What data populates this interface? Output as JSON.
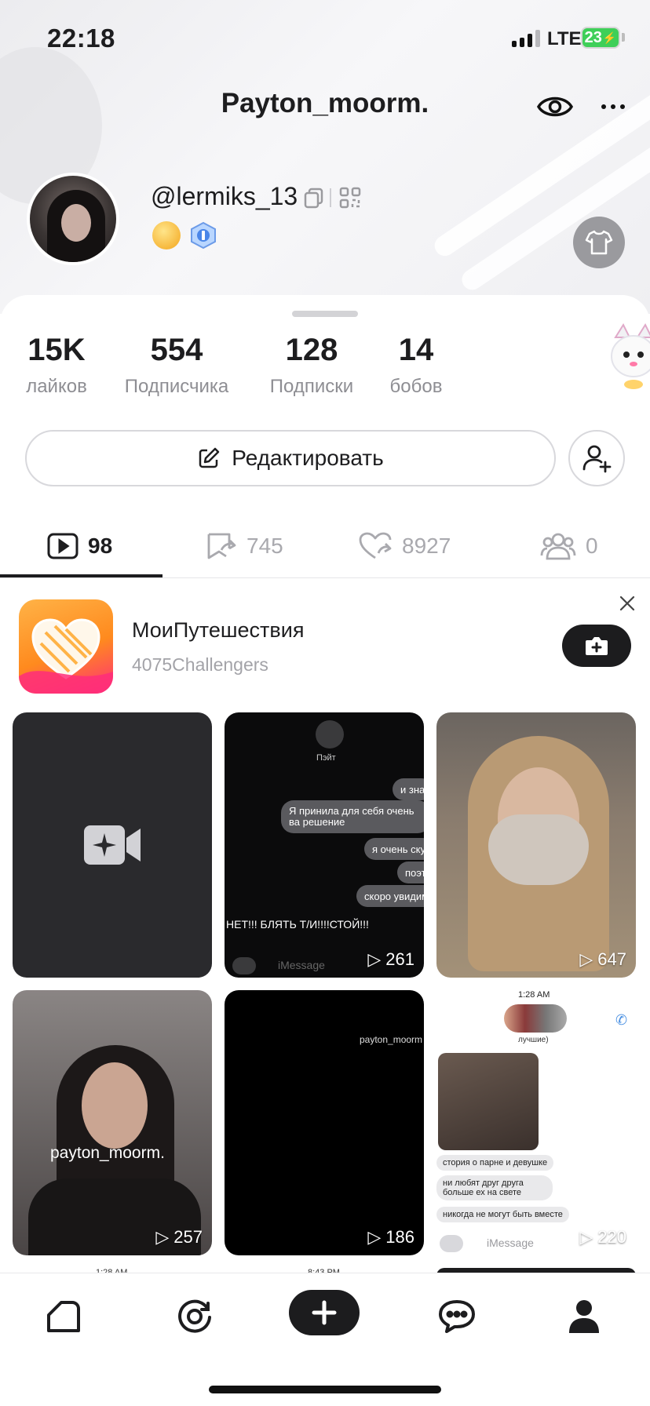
{
  "status_bar": {
    "time": "22:18",
    "network": "LTE",
    "battery": "23"
  },
  "header": {
    "title": "Payton_moorm."
  },
  "profile": {
    "username": "@lermiks_13"
  },
  "stats": [
    {
      "value": "15K",
      "label": "лайков"
    },
    {
      "value": "554",
      "label": "Подписчика"
    },
    {
      "value": "128",
      "label": "Подписки"
    },
    {
      "value": "14",
      "label": "бобов"
    }
  ],
  "actions": {
    "edit_label": "Редактировать"
  },
  "tabs": [
    {
      "icon": "video-icon",
      "count": "98"
    },
    {
      "icon": "repost-icon",
      "count": "745"
    },
    {
      "icon": "liked-icon",
      "count": "8927"
    },
    {
      "icon": "friends-icon",
      "count": "0"
    }
  ],
  "promo": {
    "title": "МоиПутешествия",
    "subtitle": "4075Challengers"
  },
  "videos": [
    {
      "kind": "draft",
      "views": ""
    },
    {
      "kind": "chat",
      "views": "261",
      "contact": "Пэйт",
      "messages": [
        "и зна",
        "Я принила для себя очень ва решение",
        "я очень ску",
        "поэт",
        "скоро увидим"
      ],
      "overlay": "НЕТ!!! БЛЯТЬ Т/И!!!!СТОЙ!!!",
      "input": "iMessage"
    },
    {
      "kind": "photo",
      "views": "647"
    },
    {
      "kind": "photo",
      "views": "257",
      "caption": "payton_moorm."
    },
    {
      "kind": "dark",
      "views": "186",
      "caption": "payton_moorm"
    },
    {
      "kind": "chat-light",
      "views": "220",
      "time": "1:28 AM",
      "subtitle": "лучшие)",
      "messages": [
        "стория о парне и девушке",
        "ни любят друг друга больше ех на свете",
        "никогда не могут быть вместе"
      ],
      "input": "iMessage"
    }
  ],
  "partial_row": [
    "1:28 AM",
    "8:43 PM"
  ],
  "colors": {
    "accent": "#1c1c1e",
    "muted": "#8e8e93",
    "battery": "#3ecf58"
  }
}
